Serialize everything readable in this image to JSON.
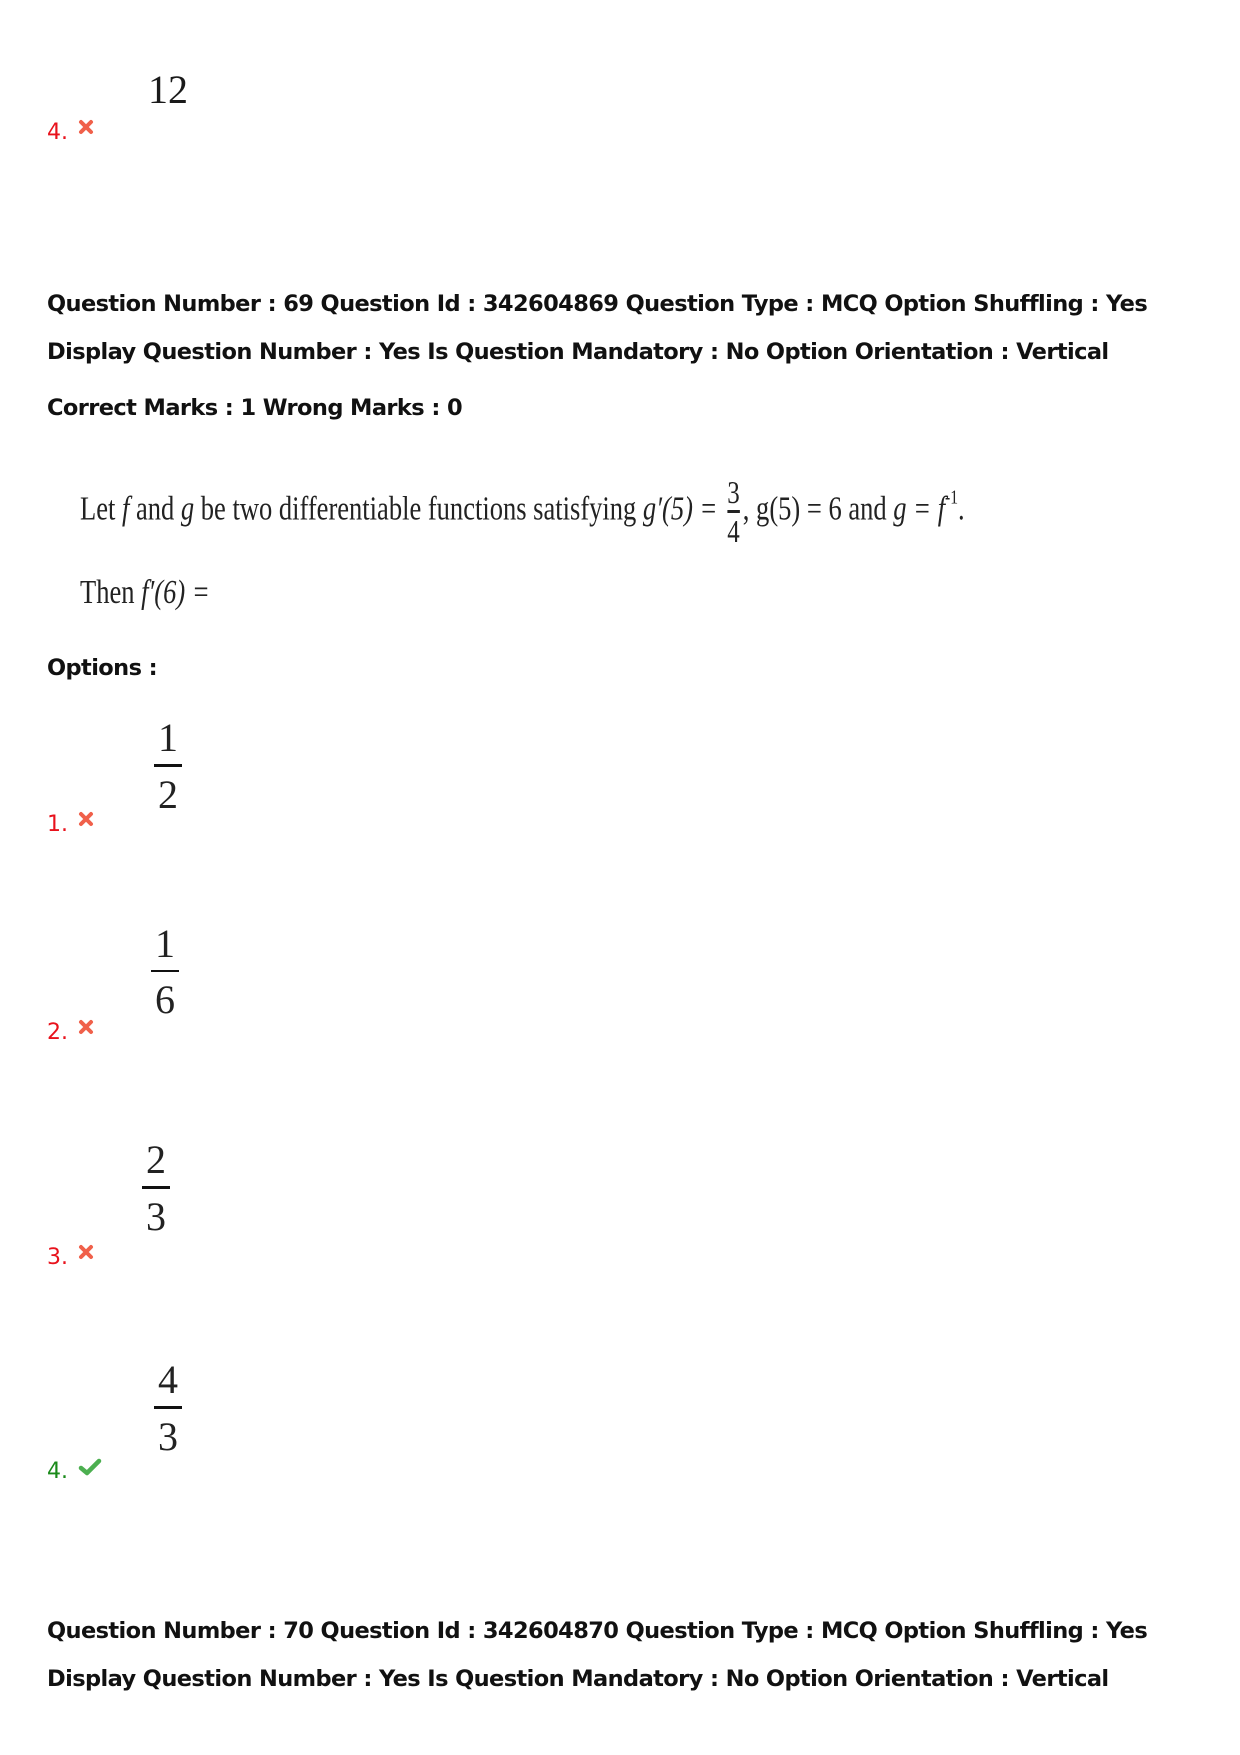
{
  "previous_question": {
    "option_value": "12",
    "option_number": "4.",
    "option_status": "wrong"
  },
  "q69": {
    "header_line1": "Question Number : 69 Question Id : 342604869 Question Type : MCQ Option Shuffling : Yes",
    "header_line2": "Display Question Number : Yes Is Question Mandatory : No Option Orientation : Vertical",
    "header_line3": "Correct Marks : 1 Wrong Marks : 0",
    "question": {
      "line1_prefix": "Let ",
      "f": "f",
      "and": " and ",
      "g": "g",
      "line1_mid": " be two differentiable functions satisfying ",
      "gprime5": "g′(5) =",
      "frac_num": "3",
      "frac_den": "4",
      "line1_rest": ", g(5) = 6 and ",
      "g_eq": "g = f",
      "inv": "-1",
      "period": ".",
      "line2_prefix": "Then ",
      "line2_expr": "f′(6) ="
    },
    "options_label": "Options :",
    "options": [
      {
        "number": "1.",
        "numerator": "1",
        "denominator": "2",
        "status": "wrong"
      },
      {
        "number": "2.",
        "numerator": "1",
        "denominator": "6",
        "status": "wrong"
      },
      {
        "number": "3.",
        "numerator": "2",
        "denominator": "3",
        "status": "wrong"
      },
      {
        "number": "4.",
        "numerator": "4",
        "denominator": "3",
        "status": "correct"
      }
    ]
  },
  "q70": {
    "header_line1": "Question Number : 70 Question Id : 342604870 Question Type : MCQ Option Shuffling : Yes",
    "header_line2": "Display Question Number : Yes Is Question Mandatory : No Option Orientation : Vertical"
  },
  "colors": {
    "wrong": "#e8121c",
    "correct": "#1a8a1a",
    "x_icon": "#f0604a",
    "check_icon": "#4caf50"
  }
}
